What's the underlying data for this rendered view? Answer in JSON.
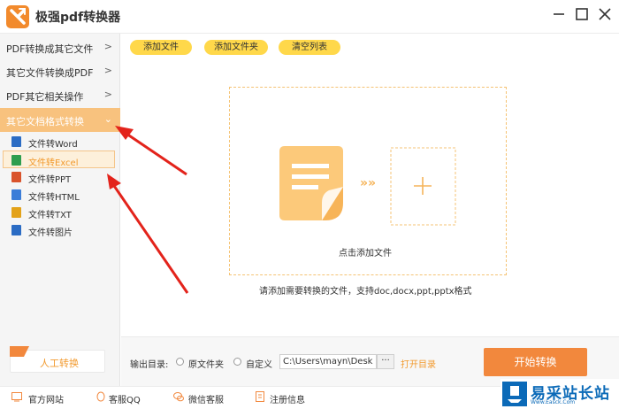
{
  "app": {
    "title": "极强pdf转换器"
  },
  "sidebar": {
    "items": [
      {
        "label": "PDF转换成其它文件",
        "chevron": ">"
      },
      {
        "label": "其它文件转换成PDF",
        "chevron": ">"
      },
      {
        "label": "PDF其它相关操作",
        "chevron": ">"
      },
      {
        "label": "其它文档格式转换",
        "chevron": "⌄"
      }
    ],
    "sub_items": [
      {
        "label": "文件转Word",
        "icon": "word-icon",
        "color": "#2b6cc4"
      },
      {
        "label": "文件转Excel",
        "icon": "excel-icon",
        "color": "#2e9e4f"
      },
      {
        "label": "文件转PPT",
        "icon": "ppt-icon",
        "color": "#d9532c"
      },
      {
        "label": "文件转HTML",
        "icon": "html-icon",
        "color": "#3b7dd8"
      },
      {
        "label": "文件转TXT",
        "icon": "txt-icon",
        "color": "#e3a21a"
      },
      {
        "label": "文件转图片",
        "icon": "image-icon",
        "color": "#2b6cc4"
      }
    ],
    "manual_button": "人工转换"
  },
  "toolbar": {
    "add_file": "添加文件",
    "add_folder": "添加文件夹",
    "clear_list": "清空列表"
  },
  "dropzone": {
    "add_file_text": "点击添加文件",
    "hint": "请添加需要转换的文件，支持doc,docx,ppt,pptx格式",
    "arrow_glyph": "»»"
  },
  "output": {
    "label": "输出目录:",
    "option_original": "原文件夹",
    "option_custom": "自定义",
    "path": "C:\\Users\\mayn\\Desk",
    "browse": "···",
    "open_dir": "打开目录",
    "start": "开始转换"
  },
  "footer": {
    "items": [
      {
        "label": "官方网站",
        "icon": "website-icon"
      },
      {
        "label": "客服QQ",
        "icon": "qq-icon"
      },
      {
        "label": "微信客服",
        "icon": "wechat-icon"
      },
      {
        "label": "注册信息",
        "icon": "register-icon"
      }
    ]
  },
  "watermark": {
    "text": "易采站长站",
    "sub": "Www.Easck.Com"
  },
  "colors": {
    "accent": "#f2883d",
    "highlight": "#f8c27e",
    "pill": "#ffd84a",
    "arrow": "#e3231b"
  }
}
